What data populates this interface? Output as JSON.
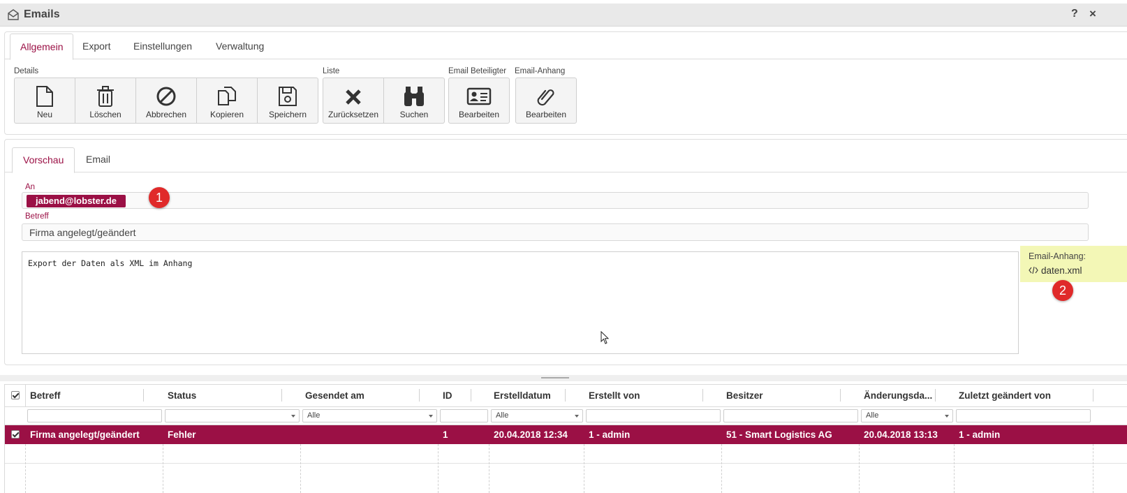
{
  "window": {
    "title": "Emails",
    "help_label": "?",
    "close_label": "×"
  },
  "main_tabs": [
    {
      "label": "Allgemein",
      "active": true
    },
    {
      "label": "Export"
    },
    {
      "label": "Einstellungen"
    },
    {
      "label": "Verwaltung"
    }
  ],
  "toolbar": {
    "groups": {
      "details": "Details",
      "liste": "Liste",
      "email_beteiligter": "Email Beteiligter",
      "email_anhang": "Email-Anhang"
    },
    "buttons": {
      "neu": {
        "label": "Neu",
        "icon": "file-icon"
      },
      "loeschen": {
        "label": "Löschen",
        "icon": "trash-icon"
      },
      "abbrechen": {
        "label": "Abbrechen",
        "icon": "cancel-icon"
      },
      "kopieren": {
        "label": "Kopieren",
        "icon": "copy-icon"
      },
      "speichern": {
        "label": "Speichern",
        "icon": "save-icon"
      },
      "zuruecksetzen": {
        "label": "Zurücksetzen",
        "icon": "x-icon"
      },
      "suchen": {
        "label": "Suchen",
        "icon": "binoculars-icon"
      },
      "beteiligter_bearbeiten": {
        "label": "Bearbeiten",
        "icon": "id-card-icon"
      },
      "anhang_bearbeiten": {
        "label": "Bearbeiten",
        "icon": "paperclip-icon"
      }
    }
  },
  "detail_tabs": [
    {
      "label": "Vorschau",
      "active": true
    },
    {
      "label": "Email"
    }
  ],
  "preview": {
    "to_label": "An",
    "to_chip": "jabend@lobster.de",
    "subject_label": "Betreff",
    "subject_value": "Firma angelegt/geändert",
    "body": "Export der Daten als XML im Anhang",
    "attachment_label": "Email-Anhang:",
    "attachment_file": "daten.xml",
    "badge1": "1",
    "badge2": "2"
  },
  "grid": {
    "columns": [
      "Betreff",
      "Status",
      "Gesendet am",
      "ID",
      "Erstelldatum",
      "Erstellt von",
      "Besitzer",
      "Änderungsda...",
      "Zuletzt geändert von"
    ],
    "filters": {
      "gesendet": "Alle",
      "erstelldatum": "Alle",
      "aenderungsdatum": "Alle"
    },
    "rows": [
      {
        "betreff": "Firma angelegt/geändert",
        "status": "Fehler",
        "gesendet": "",
        "id": "1",
        "erstelldatum": "20.04.2018 12:34",
        "erstellt_von": "1 - admin",
        "besitzer": "51 - Smart Logistics AG",
        "aenderungsdatum": "20.04.2018 13:13",
        "zuletzt": "1 - admin",
        "selected": true
      }
    ]
  },
  "colors": {
    "accent": "#9b1045",
    "badge": "#e02a2a",
    "attachment_bg": "#f3f7b6"
  }
}
